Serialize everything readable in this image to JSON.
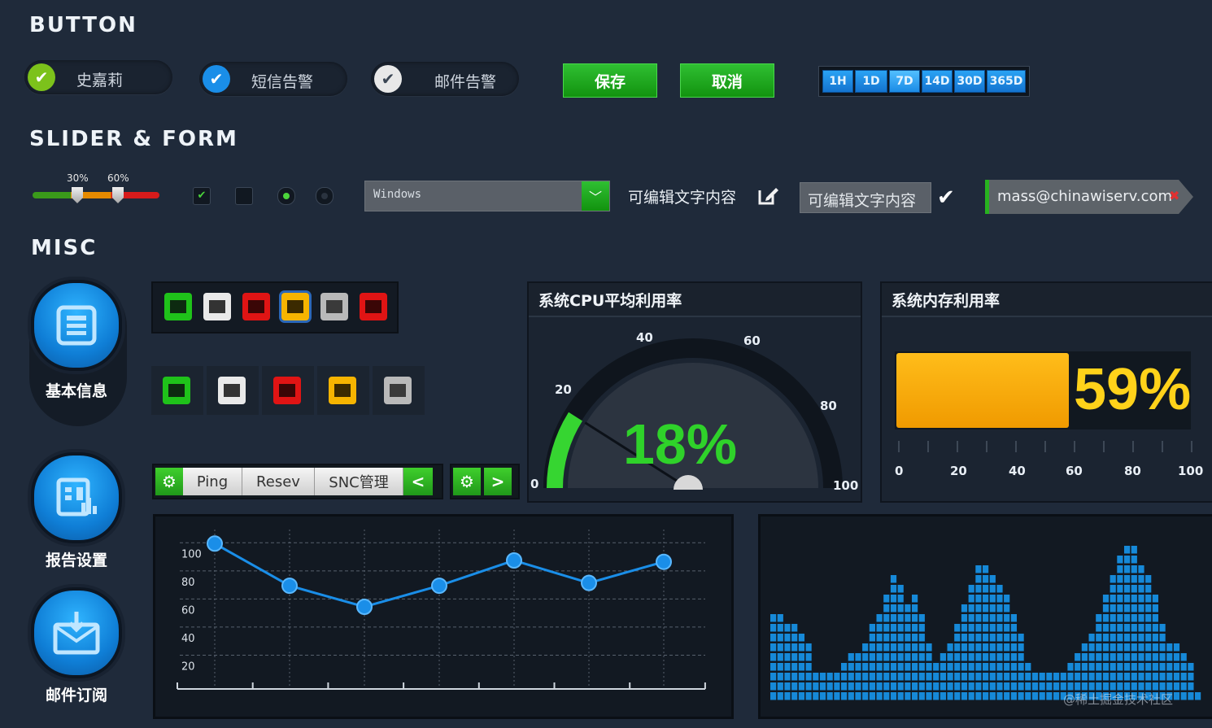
{
  "sections": {
    "button": "BUTTON",
    "slider_form": "SLIDER & FORM",
    "misc": "MISC"
  },
  "check_pills": [
    {
      "label": "史嘉莉",
      "style": "green"
    },
    {
      "label": "短信告警",
      "style": "blue"
    },
    {
      "label": "邮件告警",
      "style": "white"
    }
  ],
  "buttons": {
    "save": "保存",
    "cancel": "取消"
  },
  "time_ranges": [
    "1H",
    "1D",
    "7D",
    "14D",
    "30D",
    "365D"
  ],
  "time_range_selected": "7D",
  "slider": {
    "labels": [
      "30%",
      "60%"
    ],
    "values": [
      30,
      60
    ]
  },
  "select": {
    "value": "Windows",
    "arrow_icon": "chevron-down-icon"
  },
  "editable": {
    "text1": "可编辑文字内容",
    "text2": "可编辑文字内容"
  },
  "email": {
    "value": "mass@chinawiserv.com"
  },
  "nav_circles": [
    {
      "label": "基本信息",
      "icon": "list-icon"
    },
    {
      "label": "报告设置",
      "icon": "report-icon"
    },
    {
      "label": "邮件订阅",
      "icon": "mail-download-icon"
    }
  ],
  "net_icons_row1": [
    "#1fc21a",
    "#e9e9e9",
    "#e01414",
    "#f6b400",
    "#b9b9b9",
    "#e01414"
  ],
  "net_icons_row2": [
    "#1fc21a",
    "#e9e9e9",
    "#e01414",
    "#f6b400",
    "#b9b9b9"
  ],
  "toolbar": {
    "items": [
      "Ping",
      "Resev",
      "SNC管理"
    ]
  },
  "cpu": {
    "title": "系统CPU平均利用率",
    "value": 18,
    "value_text": "18%",
    "ticks": [
      "0",
      "20",
      "40",
      "60",
      "80",
      "100"
    ]
  },
  "memory": {
    "title": "系统内存利用率",
    "value": 59,
    "value_text": "59%",
    "ticks": [
      "0",
      "20",
      "40",
      "60",
      "80",
      "100"
    ]
  },
  "chart_data": [
    {
      "type": "line",
      "x": [
        1,
        2,
        3,
        4,
        5,
        6,
        7
      ],
      "y": [
        100,
        70,
        55,
        70,
        88,
        72,
        87
      ],
      "yticks": [
        "20",
        "40",
        "60",
        "80",
        "100"
      ],
      "ylim": [
        0,
        110
      ]
    },
    {
      "type": "bar",
      "values": [
        9,
        9,
        8,
        8,
        7,
        6,
        3,
        3,
        3,
        3,
        4,
        5,
        5,
        6,
        8,
        9,
        11,
        13,
        12,
        10,
        11,
        9,
        6,
        4,
        5,
        6,
        8,
        10,
        12,
        14,
        14,
        13,
        12,
        11,
        9,
        7,
        4,
        3,
        3,
        3,
        3,
        3,
        4,
        5,
        6,
        7,
        9,
        11,
        13,
        15,
        16,
        16,
        14,
        13,
        11,
        8,
        6,
        6,
        5,
        4,
        1
      ],
      "max": 17
    }
  ],
  "watermark": "@稀土掘金技术社区",
  "colors": {
    "green": "#1fae1a",
    "blue": "#1a8ee8",
    "orange": "#f0a300",
    "gauge_green": "#36d531",
    "bg": "#1f2a3a"
  }
}
